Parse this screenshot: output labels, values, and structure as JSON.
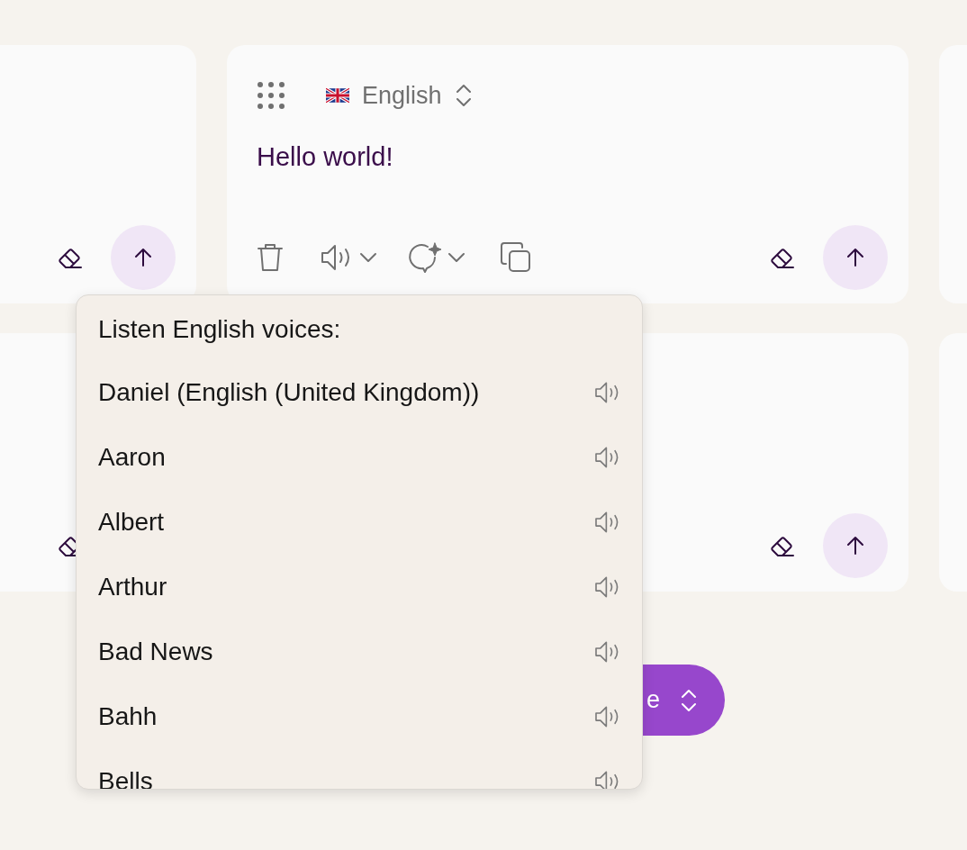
{
  "translation_card": {
    "language": "English",
    "text": "Hello world!"
  },
  "voice_menu": {
    "title": "Listen English voices:",
    "voices": [
      {
        "name": "Daniel (English (United Kingdom))"
      },
      {
        "name": "Aaron"
      },
      {
        "name": "Albert"
      },
      {
        "name": "Arthur"
      },
      {
        "name": "Bad News"
      },
      {
        "name": "Bahh"
      },
      {
        "name": "Bells"
      }
    ]
  },
  "bottom_button": {
    "label": "e"
  }
}
